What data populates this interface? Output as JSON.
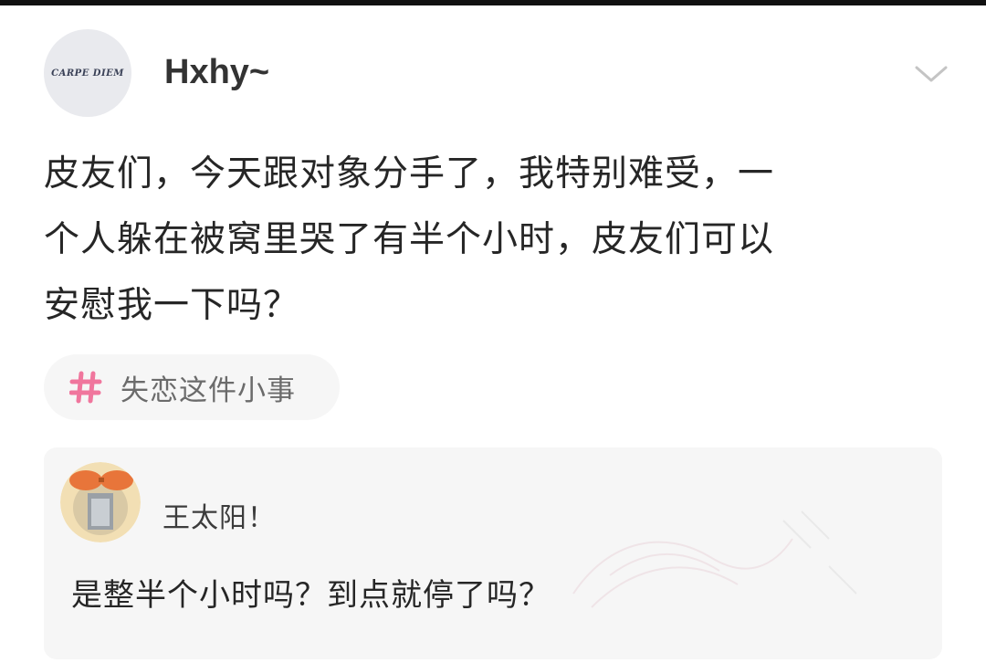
{
  "post": {
    "author": {
      "avatar_text": "CARPE DIEM",
      "name": "Hxhy~"
    },
    "menu_icon": "chevron-down-icon",
    "lines": [
      "皮友们，今天跟对象分手了，我特别难受，一",
      "个人躲在被窝里哭了有半个小时，皮友们可以",
      "安慰我一下吗？"
    ],
    "topic": {
      "icon": "hashtag-icon",
      "label": "失恋这件小事"
    }
  },
  "comment": {
    "author": "王太阳！",
    "text": "是整半个小时吗？到点就停了吗？"
  },
  "colors": {
    "topic_hash": "#f0769d",
    "card_background": "#f6f6f6",
    "avatar_background": "#e9eaee"
  }
}
